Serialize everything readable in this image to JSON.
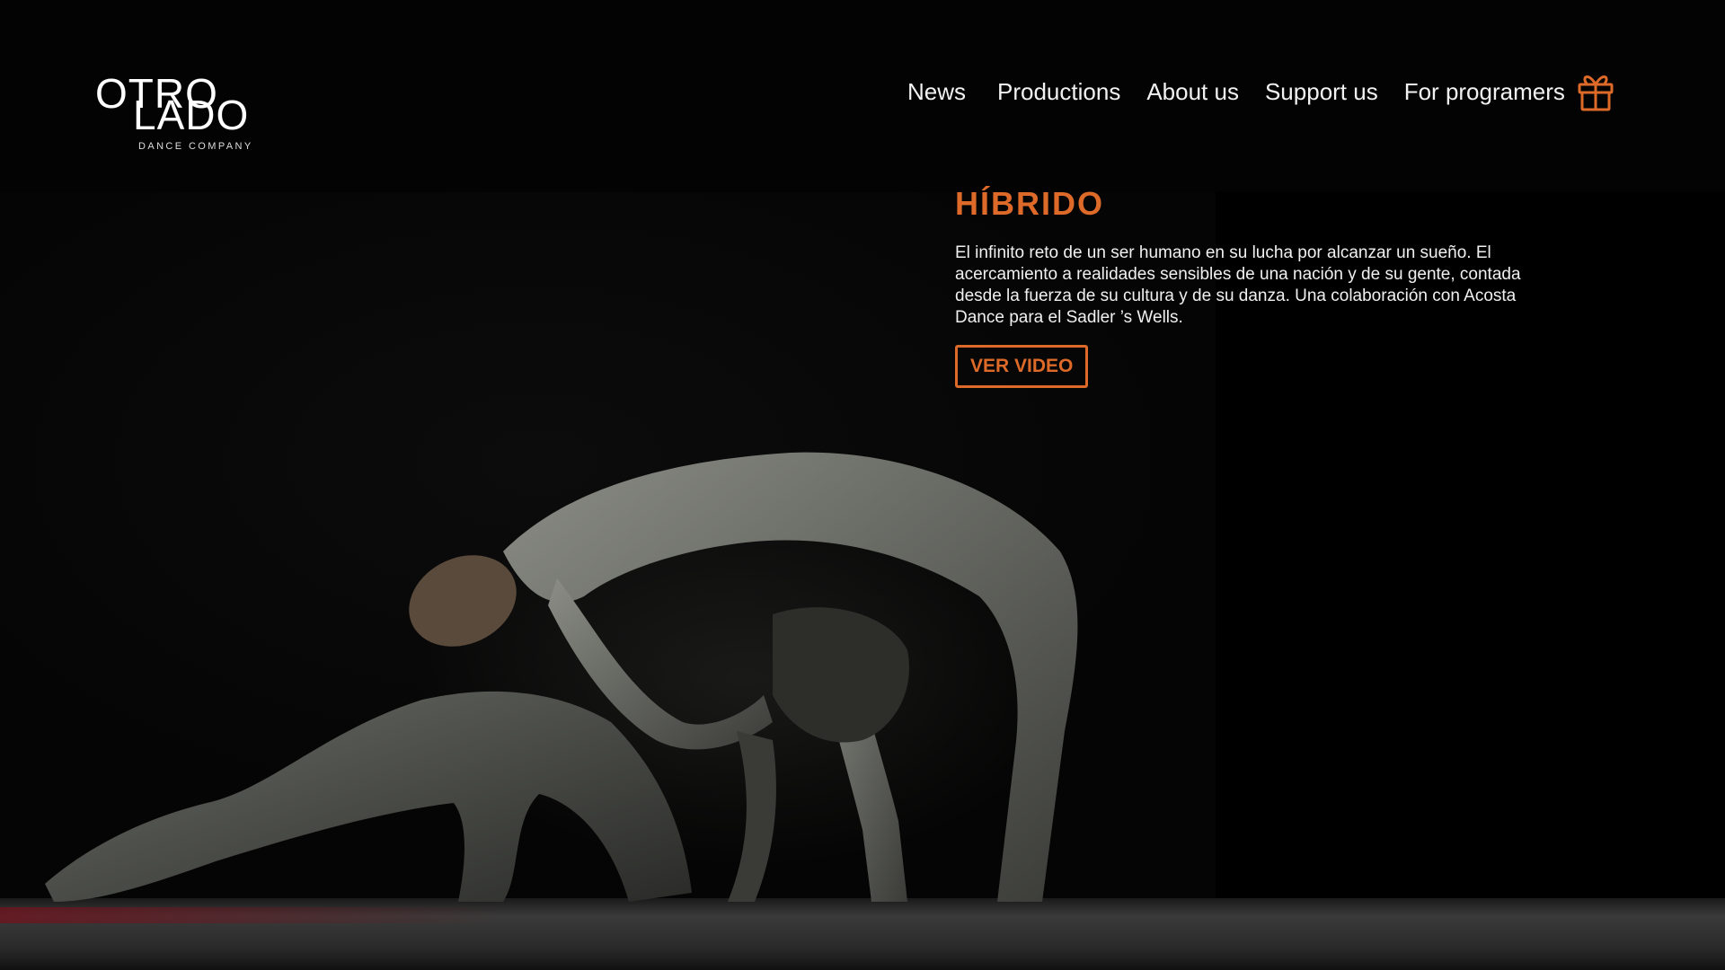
{
  "brand": {
    "logo_line1": "OTRO",
    "logo_line2": "LADO",
    "logo_tagline": "DANCE COMPANY"
  },
  "nav": {
    "items": [
      {
        "label": "News"
      },
      {
        "label": "Productions"
      },
      {
        "label": "About us"
      },
      {
        "label": "Support us"
      },
      {
        "label": "For programers"
      }
    ],
    "gift_icon": "gift-icon"
  },
  "hero": {
    "title": "HÍBRIDO",
    "description": "El infinito reto de un ser humano en su lucha por alcanzar un sueño. El acercamiento a realidades sensibles de una nación y de su gente, contada desde la fuerza de su cultura y de su danza. Una colaboración con Acosta Dance para el Sadler ’s Wells.",
    "button_label": "VER VIDEO"
  },
  "colors": {
    "accent": "#dd6a28",
    "background": "#000000",
    "text": "#f0f0f0"
  }
}
